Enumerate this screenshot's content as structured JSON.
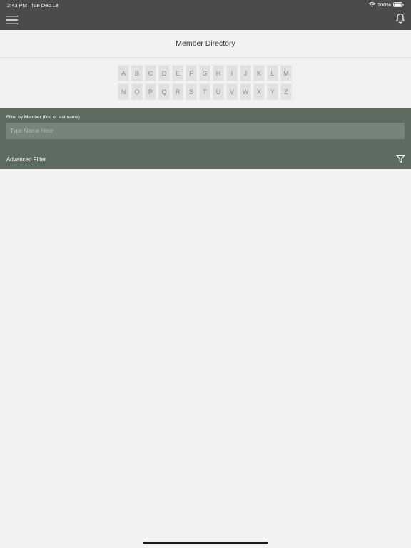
{
  "status_bar": {
    "time": "2:43 PM",
    "date": "Tue Dec 13",
    "battery": "100%",
    "icons": [
      "wifi-icon",
      "battery-icon"
    ]
  },
  "nav": {
    "menu_icon": "hamburger-menu-icon",
    "notification_icon": "bell-icon"
  },
  "page": {
    "title": "Member Directory"
  },
  "alphabet": {
    "row1": [
      "A",
      "B",
      "C",
      "D",
      "E",
      "F",
      "G",
      "H",
      "I",
      "J",
      "K",
      "L",
      "M"
    ],
    "row2": [
      "N",
      "O",
      "P",
      "Q",
      "R",
      "S",
      "T",
      "U",
      "V",
      "W",
      "X",
      "Y",
      "Z"
    ]
  },
  "filter": {
    "label": "Filter by Member (first or last name)",
    "placeholder": "Type Name Here",
    "value": "",
    "advanced_label": "Advanced Filter",
    "advanced_icon": "funnel-filter-icon"
  },
  "colors": {
    "header_bg": "#4b4b4b",
    "filter_panel_bg": "#5d6b61",
    "input_bg": "#76847a",
    "page_bg": "#f2f2f2",
    "letter_bg": "#e1e1e1"
  }
}
